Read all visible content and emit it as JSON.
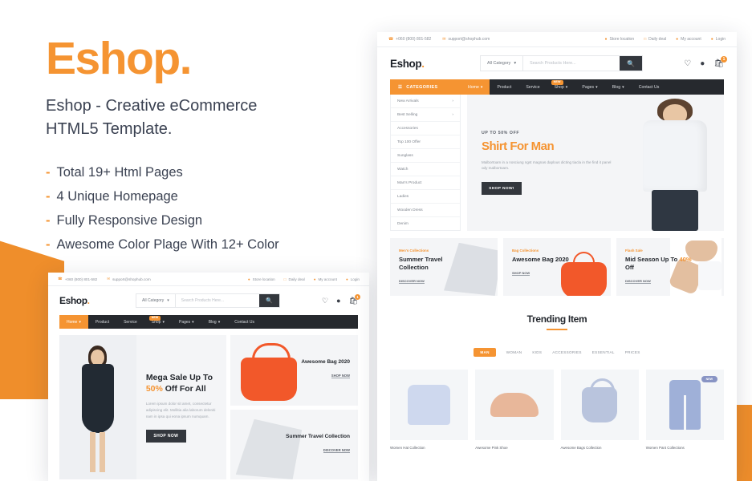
{
  "promo": {
    "logo": "Eshop.",
    "subtitle_line1": "Eshop - Creative eCommerce",
    "subtitle_line2": "HTML5 Template.",
    "dash": "-",
    "features": [
      "Total 19+ Html Pages",
      "4 Unique Homepage",
      "Fully Responsive Design",
      "Awesome Color Plage With 12+ Color"
    ]
  },
  "colors": {
    "brand_orange": "#f59432",
    "dark": "#26292e",
    "accent_red": "#f2582a"
  },
  "site": {
    "topbar": {
      "phone": "+060 (800) 801-582",
      "email": "support@shophub.com",
      "links": [
        "Store location",
        "Daily deal",
        "My account",
        "Login"
      ]
    },
    "header": {
      "logo": "Eshop",
      "logo_dot": ".",
      "category_select": "All Category",
      "search_placeholder": "Search Products Here...",
      "cart_count": "1"
    },
    "nav": {
      "categories_label": "CATEGORIES",
      "new_badge": "NEW",
      "items": [
        {
          "label": "Home",
          "caret": true,
          "active": true
        },
        {
          "label": "Product",
          "caret": false,
          "active": false
        },
        {
          "label": "Service",
          "caret": false,
          "active": false
        },
        {
          "label": "Shop",
          "caret": true,
          "active": false
        },
        {
          "label": "Pages",
          "caret": true,
          "active": false
        },
        {
          "label": "Blog",
          "caret": true,
          "active": false
        },
        {
          "label": "Contact Us",
          "caret": false,
          "active": false
        }
      ]
    },
    "sidebar": [
      {
        "label": "New Arrivals",
        "arrow": true
      },
      {
        "label": "Best Selling",
        "arrow": true
      },
      {
        "label": "Accessories",
        "arrow": false
      },
      {
        "label": "Top 100 Offer",
        "arrow": false
      },
      {
        "label": "Sunglass",
        "arrow": false
      },
      {
        "label": "Watch",
        "arrow": false
      },
      {
        "label": "Man's Product",
        "arrow": false
      },
      {
        "label": "Ladies",
        "arrow": false
      },
      {
        "label": "Wooden Dress",
        "arrow": false
      },
      {
        "label": "Denim",
        "arrow": false
      }
    ],
    "hero": {
      "kicker": "UP TO 50% OFF",
      "title": "Shirt For Man",
      "text": "Malbortoam in a nosciung ngst magnas daplous dicting tiacla in the find it panel ody malbortoam.",
      "button": "SHOP NOW!"
    },
    "promo_cards": [
      {
        "kicker": "Men's Collections",
        "title": "Summer Travel Collection",
        "link": "DISCOVER NOW"
      },
      {
        "kicker": "Bag Collections",
        "title": "Awesome Bag 2020",
        "link": "SHOP NOW"
      },
      {
        "kicker": "Flash Sale",
        "title_pre": "Mid Season Up To ",
        "title_hl": "40%",
        "title_post": " Off",
        "link": "DISCOVER NOW"
      }
    ],
    "trending": {
      "title": "Trending Item",
      "tabs": [
        "MAN",
        "WOMAN",
        "KIDS",
        "ACCESSORIES",
        "ESSENTIAL",
        "PRICES"
      ],
      "products": [
        {
          "name": "Women Hat Collection",
          "badge": ""
        },
        {
          "name": "Awesome Pink Shoe",
          "badge": ""
        },
        {
          "name": "Awesome Bags Collection",
          "badge": ""
        },
        {
          "name": "Women Pant Collections",
          "badge": "NEW"
        }
      ]
    }
  },
  "site2": {
    "hero": {
      "title_pre": "Mega Sale Up To ",
      "title_hl": "50%",
      "title_post": " Off For All",
      "text": "Lorem ipsum dolor sit amet, consectetur adipiscing elit. Mollitia alia laborum deleniti nam in ipsa qui eona ipsum numquam.",
      "button": "SHOP NOW"
    },
    "cards": [
      {
        "title": "Awesome Bag 2020",
        "link": "SHOP NOW"
      },
      {
        "title": "Summer Travel Collection",
        "link": "DISCOVER NOW"
      }
    ]
  }
}
